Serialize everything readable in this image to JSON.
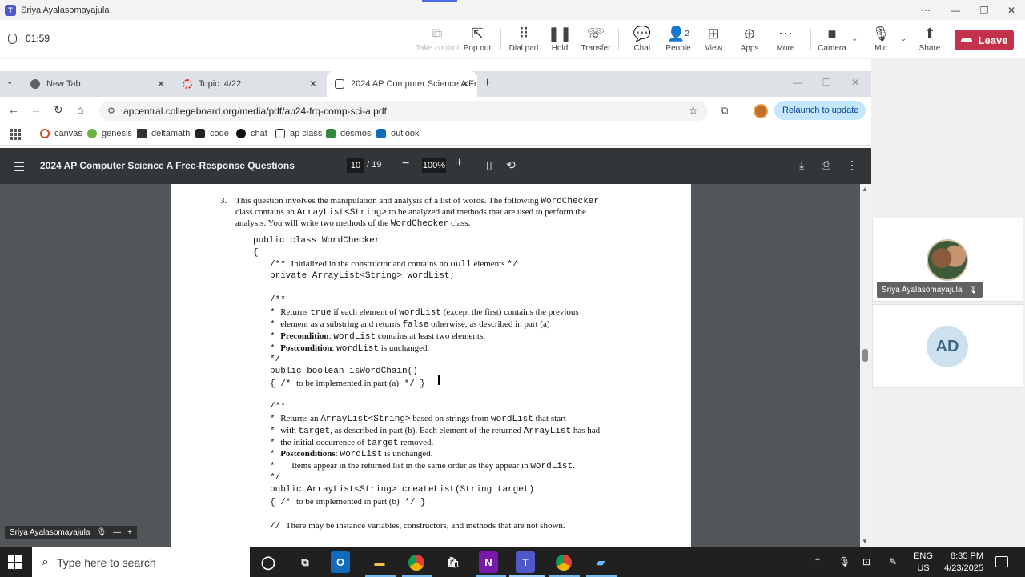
{
  "teams": {
    "window_title": "Sriya Ayalasomayajula",
    "meeting_timer": "01:59",
    "toolbar": {
      "take_control": "Take control",
      "pop_out": "Pop out",
      "dial_pad": "Dial pad",
      "hold": "Hold",
      "transfer": "Transfer",
      "chat": "Chat",
      "people": "People",
      "people_count": "2",
      "view": "View",
      "apps": "Apps",
      "more": "More",
      "camera": "Camera",
      "mic": "Mic",
      "share": "Share",
      "leave": "Leave"
    },
    "participants": [
      {
        "name": "Sriya Ayalasomayajula"
      },
      {
        "initials": "AD"
      }
    ],
    "self_view_name": "Sriya Ayalasomayajula"
  },
  "browser": {
    "tabs": [
      {
        "label": "New Tab"
      },
      {
        "label": "Topic: 4/22"
      },
      {
        "label": "2024 AP Computer Science A Fr"
      }
    ],
    "url": "apcentral.collegeboard.org/media/pdf/ap24-frq-comp-sci-a.pdf",
    "relaunch_label": "Relaunch to update",
    "bookmarks": [
      {
        "label": "canvas"
      },
      {
        "label": "genesis"
      },
      {
        "label": "deltamath"
      },
      {
        "label": "code"
      },
      {
        "label": "chat"
      },
      {
        "label": "ap class"
      },
      {
        "label": "desmos"
      },
      {
        "label": "outlook"
      }
    ]
  },
  "pdf": {
    "title": "2024 AP Computer Science A Free-Response Questions",
    "page_current": "10",
    "page_total": "/ 19",
    "zoom": "100%",
    "lines": {
      "q_num": "3.",
      "intro1a": "This question involves the manipulation and analysis of a list of words. The following ",
      "intro1b": "WordChecker",
      "intro2a": "class contains an ",
      "intro2b": "ArrayList<String>",
      "intro2c": " to be analyzed and methods that are used to perform the",
      "intro3a": "analysis. You will write two methods of the ",
      "intro3b": "WordChecker",
      "intro3c": " class.",
      "c1": "public class WordChecker",
      "c2": "{",
      "c3a": "/** ",
      "c3b": "Initialized in the constructor and contains no ",
      "c3c": "null",
      "c3d": " elements ",
      "c3e": "*/",
      "c4": "private ArrayList<String> wordList;",
      "d1": "/**",
      "d2a": " *   ",
      "d2b": "Returns ",
      "d2c": "true",
      "d2d": " if each element of ",
      "d2e": "wordList",
      "d2f": " (except the first) contains the previous",
      "d3a": " *   ",
      "d3b": "element as a substring and returns ",
      "d3c": "false",
      "d3d": " otherwise, as described in part (a)",
      "d4a": " *   ",
      "d4b": "Precondition",
      "d4c": ": ",
      "d4d": "wordList",
      "d4e": " contains at least two elements.",
      "d5a": " *   ",
      "d5b": "Postcondition",
      "d5c": ": ",
      "d5d": "wordList",
      "d5e": " is unchanged.",
      "d6": " */",
      "m1": "public boolean isWordChain()",
      "m2a": "{  /* ",
      "m2b": "to be implemented in part (a)",
      "m2c": " */  }",
      "e1": "/**",
      "e2a": " *   ",
      "e2b": "Returns an ",
      "e2c": "ArrayList<String>",
      "e2d": " based on strings from ",
      "e2e": "wordList",
      "e2f": " that start",
      "e3a": " *   ",
      "e3b": "with ",
      "e3c": "target",
      "e3d": ", as described in part (b). Each element of the returned ",
      "e3e": "ArrayList",
      "e3f": " has had",
      "e4a": " *   ",
      "e4b": "the initial occurrence of ",
      "e4c": "target",
      "e4d": " removed.",
      "e5a": " *   ",
      "e5b": "Postconditions",
      "e5c": ": ",
      "e5d": "wordList",
      "e5e": " is unchanged.",
      "e6a": " *   ",
      "e6b": "Items appear in the returned list in the same order as they appear in ",
      "e6c": "wordList",
      "e6d": ".",
      "e7": " */",
      "n1": "public ArrayList<String> createList(String target)",
      "n2a": "{  /* ",
      "n2b": "to be implemented in part (b)",
      "n2c": " */  }",
      "f1a": "// ",
      "f1b": "There may be instance variables, constructors, and methods that are not shown."
    }
  },
  "taskbar": {
    "search_placeholder": "Type here to search",
    "lang1": "ENG",
    "lang2": "US",
    "time": "8:35 PM",
    "date": "4/23/2025"
  }
}
